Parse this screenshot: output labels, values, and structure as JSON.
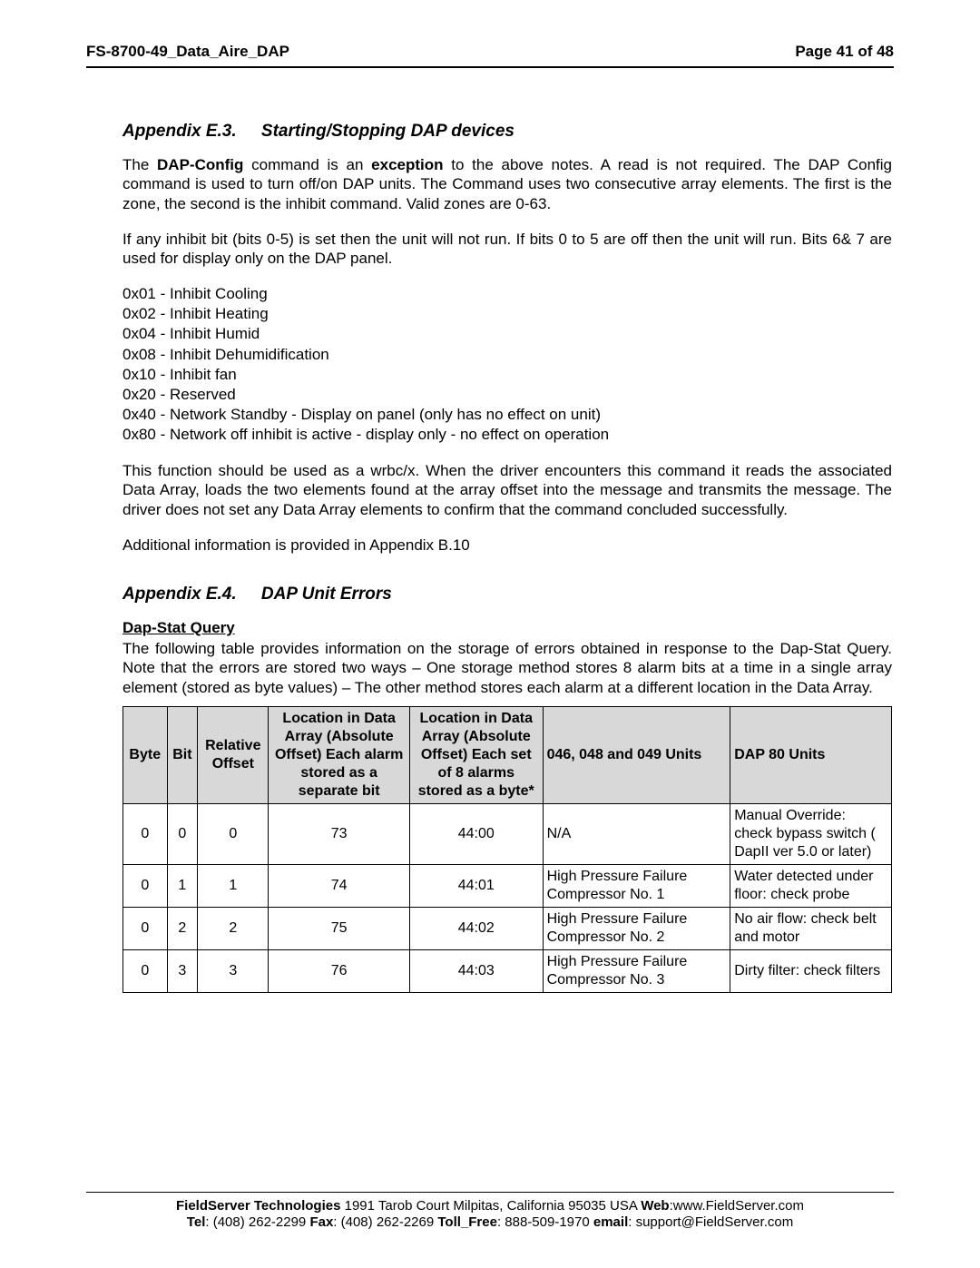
{
  "runhead": {
    "left": "FS-8700-49_Data_Aire_DAP",
    "right": "Page 41 of 48"
  },
  "e3": {
    "heading_label": "Appendix E.3.",
    "heading_title": "Starting/Stopping DAP devices",
    "para1_pre": "The ",
    "para1_b1": "DAP-Config",
    "para1_mid1": " command is an ",
    "para1_b2": "exception",
    "para1_post": " to the above notes.  A read is not required. The DAP Config command is used to turn off/on DAP units.  The Command uses two consecutive array elements.  The first is the zone, the second is the inhibit command. Valid zones are 0-63.",
    "para2": "If any inhibit bit (bits 0-5) is set then the unit will not run. If bits 0 to 5 are off then the unit will run. Bits 6& 7 are used for display only on the DAP panel.",
    "bits": [
      "0x01 - Inhibit Cooling",
      "0x02 - Inhibit Heating",
      "0x04 - Inhibit Humid",
      "0x08 - Inhibit Dehumidification",
      "0x10 - Inhibit fan",
      "0x20 - Reserved",
      "0x40 - Network Standby - Display on panel (only has no effect on unit)",
      "0x80 - Network off inhibit is active - display only - no effect on operation"
    ],
    "para3": "This function should be used as a wrbc/x. When the driver encounters this command it reads the associated Data Array, loads the two elements found at the array offset into the message and transmits the message. The driver does not set any Data Array elements to confirm that the command concluded successfully.",
    "para4": "Additional information is provided in Appendix B.10"
  },
  "e4": {
    "heading_label": "Appendix E.4.",
    "heading_title": "DAP Unit Errors",
    "subhead": "Dap-Stat Query",
    "para": "The following table provides information on the storage of errors obtained in response to the Dap-Stat Query.  Note that the errors are stored two ways – One storage method stores 8 alarm bits at a time in a single array element (stored as byte values) – The other method stores each alarm at a different location in the Data Array.",
    "table": {
      "headers": [
        "Byte",
        "Bit",
        "Relative Offset",
        "Location in Data Array (Absolute Offset) Each alarm stored as a separate bit",
        "Location in Data Array (Absolute Offset) Each set of 8 alarms stored as a byte*",
        "046, 048 and 049 Units",
        "DAP 80 Units"
      ],
      "rows": [
        {
          "byte": "0",
          "bit": "0",
          "rel": "0",
          "loc1": "73",
          "loc2": "44:00",
          "u046": "N/A",
          "dap80": "Manual Override: check bypass switch ( DapII ver 5.0 or later)"
        },
        {
          "byte": "0",
          "bit": "1",
          "rel": "1",
          "loc1": "74",
          "loc2": "44:01",
          "u046": "High Pressure Failure Compressor No. 1",
          "dap80": "Water detected under floor: check probe"
        },
        {
          "byte": "0",
          "bit": "2",
          "rel": "2",
          "loc1": "75",
          "loc2": "44:02",
          "u046": "High Pressure Failure Compressor No. 2",
          "dap80": "No air flow: check belt and motor"
        },
        {
          "byte": "0",
          "bit": "3",
          "rel": "3",
          "loc1": "76",
          "loc2": "44:03",
          "u046": "High Pressure Failure Compressor No. 3",
          "dap80": "Dirty filter: check filters"
        }
      ]
    }
  },
  "footer": {
    "l1_b1": "FieldServer Technologies",
    "l1_t1": " 1991 Tarob Court Milpitas, California 95035 USA  ",
    "l1_b2": "Web",
    "l1_t2": ":www.FieldServer.com",
    "l2_b1": "Tel",
    "l2_t1": ": (408) 262-2299  ",
    "l2_b2": "Fax",
    "l2_t2": ": (408) 262-2269  ",
    "l2_b3": "Toll_Free",
    "l2_t3": ": 888-509-1970  ",
    "l2_b4": "email",
    "l2_t4": ": support@FieldServer.com"
  }
}
